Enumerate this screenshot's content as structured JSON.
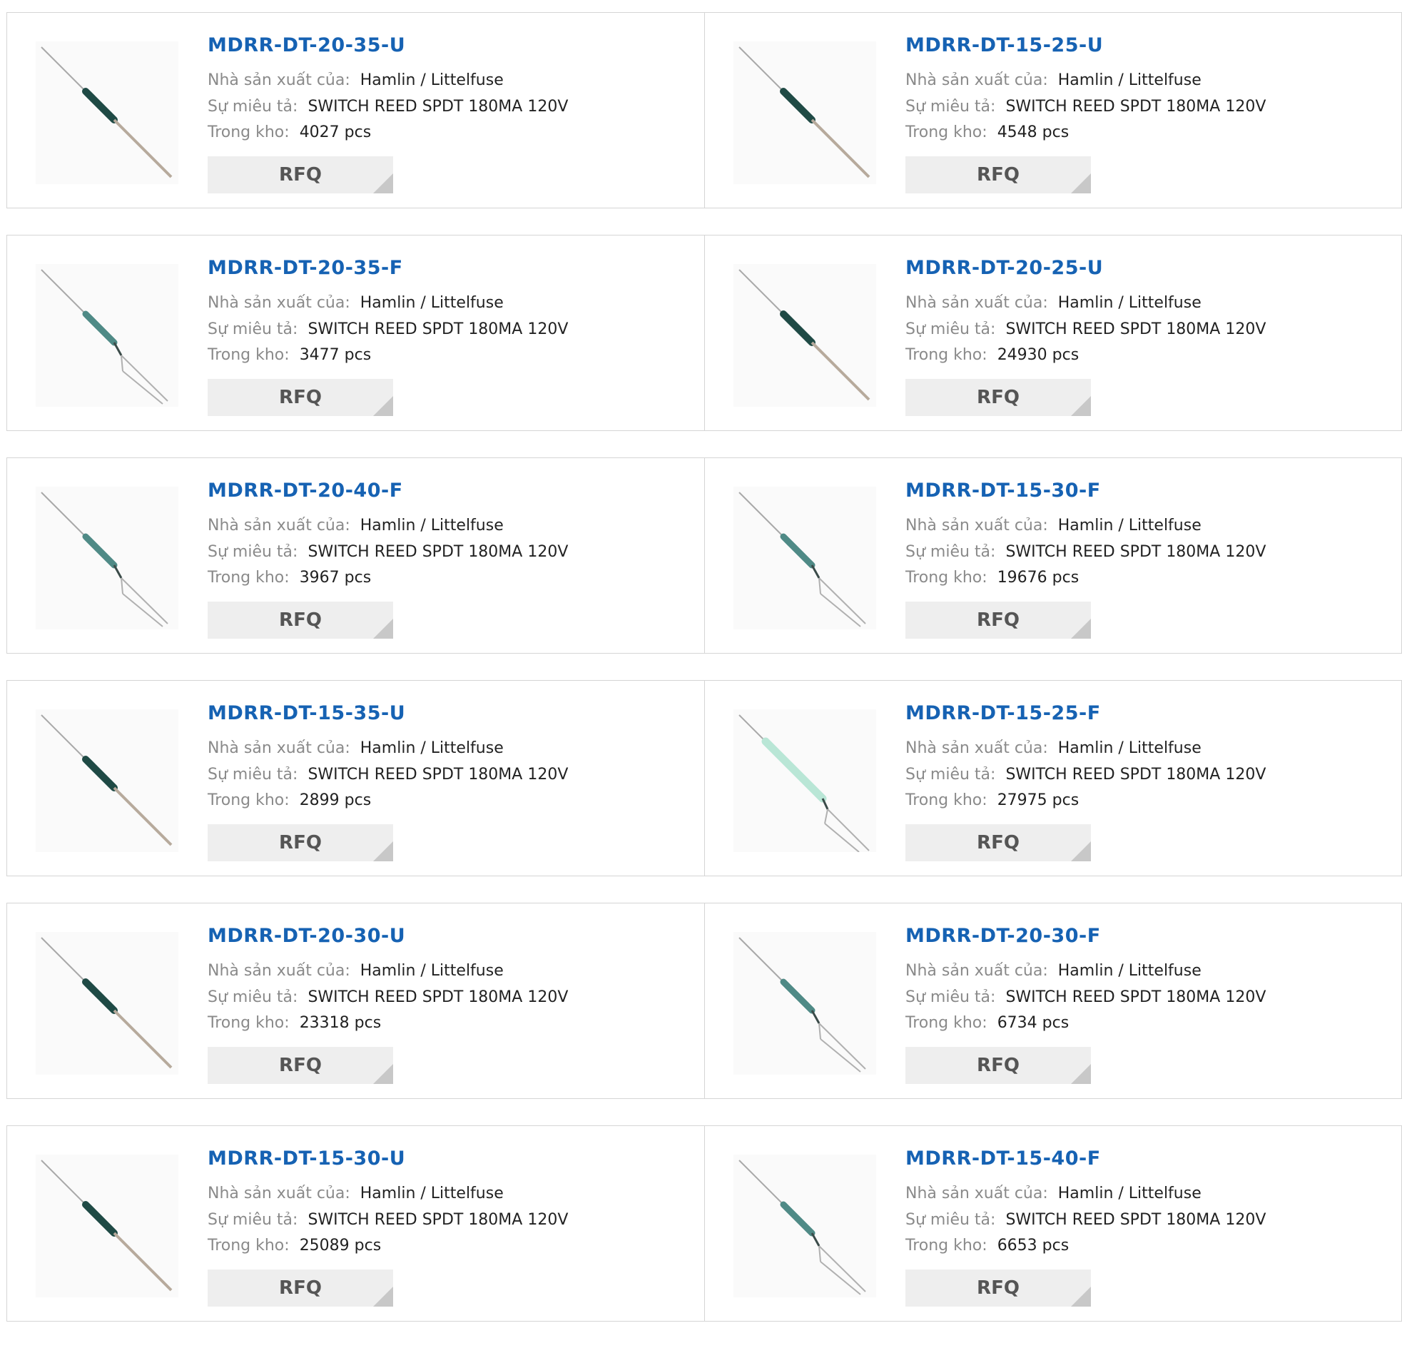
{
  "labels": {
    "manufacturer": "Nhà sản xuất của:",
    "description": "Sự miêu tả:",
    "stock": "Trong kho:",
    "rfq": "RFQ"
  },
  "products": [
    {
      "part": "MDRR-DT-20-35-U",
      "manufacturer": "Hamlin / Littelfuse",
      "description": "SWITCH REED SPDT 180MA 120V",
      "stock": "4027 pcs",
      "image": "reed-switch-u"
    },
    {
      "part": "MDRR-DT-15-25-U",
      "manufacturer": "Hamlin / Littelfuse",
      "description": "SWITCH REED SPDT 180MA 120V",
      "stock": "4548 pcs",
      "image": "reed-switch-u"
    },
    {
      "part": "MDRR-DT-20-35-F",
      "manufacturer": "Hamlin / Littelfuse",
      "description": "SWITCH REED SPDT 180MA 120V",
      "stock": "3477 pcs",
      "image": "reed-switch-f"
    },
    {
      "part": "MDRR-DT-20-25-U",
      "manufacturer": "Hamlin / Littelfuse",
      "description": "SWITCH REED SPDT 180MA 120V",
      "stock": "24930 pcs",
      "image": "reed-switch-u"
    },
    {
      "part": "MDRR-DT-20-40-F",
      "manufacturer": "Hamlin / Littelfuse",
      "description": "SWITCH REED SPDT 180MA 120V",
      "stock": "3967 pcs",
      "image": "reed-switch-f"
    },
    {
      "part": "MDRR-DT-15-30-F",
      "manufacturer": "Hamlin / Littelfuse",
      "description": "SWITCH REED SPDT 180MA 120V",
      "stock": "19676 pcs",
      "image": "reed-switch-f"
    },
    {
      "part": "MDRR-DT-15-35-U",
      "manufacturer": "Hamlin / Littelfuse",
      "description": "SWITCH REED SPDT 180MA 120V",
      "stock": "2899 pcs",
      "image": "reed-switch-u"
    },
    {
      "part": "MDRR-DT-15-25-F",
      "manufacturer": "Hamlin / Littelfuse",
      "description": "SWITCH REED SPDT 180MA 120V",
      "stock": "27975 pcs",
      "image": "reed-switch-f-clear"
    },
    {
      "part": "MDRR-DT-20-30-U",
      "manufacturer": "Hamlin / Littelfuse",
      "description": "SWITCH REED SPDT 180MA 120V",
      "stock": "23318 pcs",
      "image": "reed-switch-u"
    },
    {
      "part": "MDRR-DT-20-30-F",
      "manufacturer": "Hamlin / Littelfuse",
      "description": "SWITCH REED SPDT 180MA 120V",
      "stock": "6734 pcs",
      "image": "reed-switch-f"
    },
    {
      "part": "MDRR-DT-15-30-U",
      "manufacturer": "Hamlin / Littelfuse",
      "description": "SWITCH REED SPDT 180MA 120V",
      "stock": "25089 pcs",
      "image": "reed-switch-u"
    },
    {
      "part": "MDRR-DT-15-40-F",
      "manufacturer": "Hamlin / Littelfuse",
      "description": "SWITCH REED SPDT 180MA 120V",
      "stock": "6653 pcs",
      "image": "reed-switch-f"
    }
  ],
  "colors": {
    "title": "#1662b3",
    "label": "#8a8a8a",
    "value": "#222222",
    "border": "#d5d5d5",
    "button_bg": "#eeeeee",
    "button_text": "#555555",
    "button_corner": "#c8c8c8"
  }
}
